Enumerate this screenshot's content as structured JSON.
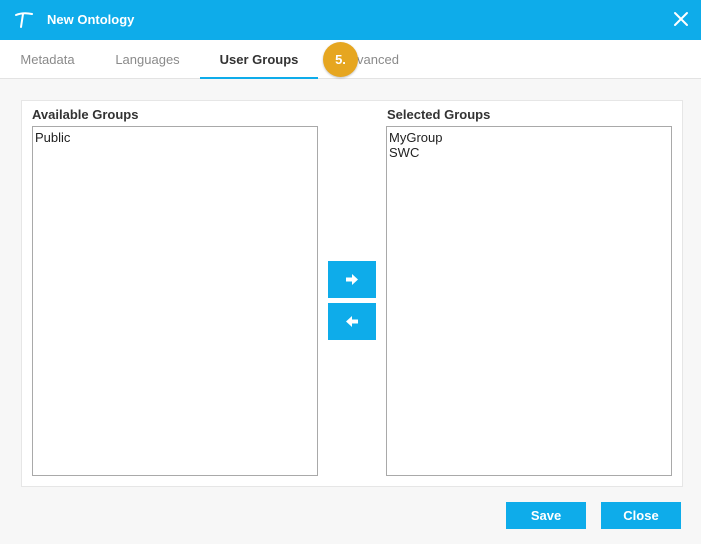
{
  "window": {
    "title": "New Ontology"
  },
  "icons": {
    "logo": "ontology-logo-icon",
    "close": "close-icon",
    "move_right": "arrow-right-icon",
    "move_left": "arrow-left-icon"
  },
  "tabs": [
    {
      "label": "Metadata",
      "active": false
    },
    {
      "label": "Languages",
      "active": false
    },
    {
      "label": "User Groups",
      "active": true
    },
    {
      "label": "vanced",
      "active": false
    }
  ],
  "step_badge": "5.",
  "available_groups": {
    "label": "Available Groups",
    "items": [
      "Public"
    ]
  },
  "selected_groups": {
    "label": "Selected Groups",
    "items": [
      "MyGroup",
      "SWC"
    ]
  },
  "footer": {
    "save_label": "Save",
    "close_label": "Close"
  },
  "colors": {
    "accent": "#0eacea",
    "badge": "#e6a620"
  }
}
